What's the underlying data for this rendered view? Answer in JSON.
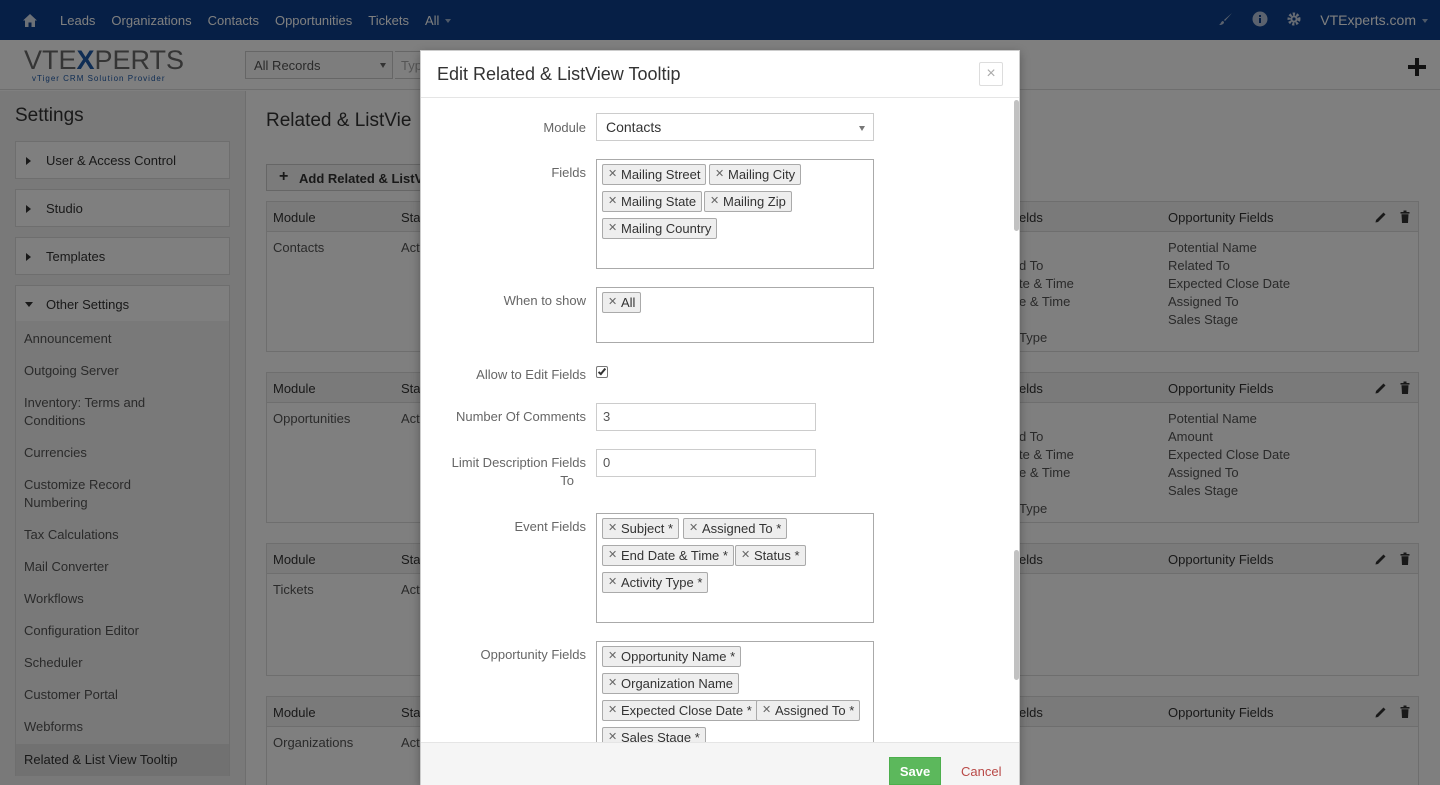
{
  "topnav": {
    "items": [
      "Leads",
      "Organizations",
      "Contacts",
      "Opportunities",
      "Tickets",
      "All"
    ],
    "user": "VTExperts.com"
  },
  "subbar": {
    "logo_main_a": "VTE",
    "logo_main_x": "X",
    "logo_main_b": "PERTS",
    "logo_sub": "vTiger CRM Solution Provider",
    "records_select": "All Records",
    "search_placeholder": "Typ"
  },
  "settings": {
    "title": "Settings",
    "panels": [
      "User & Access Control",
      "Studio",
      "Templates",
      "Other Settings"
    ],
    "submenu": [
      "Announcement",
      "Outgoing Server",
      "Inventory: Terms and Conditions",
      "Currencies",
      "Customize Record Numbering",
      "Tax Calculations",
      "Mail Converter",
      "Workflows",
      "Configuration Editor",
      "Scheduler",
      "Customer Portal",
      "Webforms",
      "Related & List View Tooltip"
    ]
  },
  "main": {
    "title": "Related & ListVie",
    "add_button": "Add Related & ListV",
    "header_module": "Module",
    "header_status": "Sta",
    "header_fields": "elds",
    "header_opp": "Opportunity Fields",
    "blocks": [
      {
        "module": "Contacts",
        "status": "Act",
        "mid": [
          "",
          "d To",
          "te & Time",
          "e & Time",
          "",
          "Type"
        ],
        "opp": [
          "Potential Name",
          "Related To",
          "Expected Close Date",
          "Assigned To",
          "Sales Stage"
        ]
      },
      {
        "module": "Opportunities",
        "status": "Act",
        "mid": [
          "",
          "d To",
          "te & Time",
          "e & Time",
          "",
          "Type"
        ],
        "opp": [
          "Potential Name",
          "Amount",
          "Expected Close Date",
          "Assigned To",
          "Sales Stage"
        ]
      },
      {
        "module": "Tickets",
        "status": "Act",
        "mid": [],
        "opp": []
      },
      {
        "module": "Organizations",
        "status": "Act",
        "mid": [],
        "opp": []
      }
    ]
  },
  "modal": {
    "title": "Edit Related & ListView Tooltip",
    "close": "×",
    "labels": {
      "module": "Module",
      "fields": "Fields",
      "when": "When to show",
      "allow_edit": "Allow to Edit Fields",
      "comments": "Number Of Comments",
      "limit_a": "Limit Description Fields",
      "limit_b": "To",
      "event": "Event Fields",
      "opportunity": "Opportunity Fields"
    },
    "module_value": "Contacts",
    "fields": [
      "Mailing Street",
      "Mailing City",
      "Mailing State",
      "Mailing Zip",
      "Mailing Country"
    ],
    "when_to_show": [
      "All"
    ],
    "allow_edit_checked": true,
    "number_of_comments": "3",
    "limit_description": "0",
    "event_fields": [
      "Subject *",
      "Assigned To *",
      "End Date & Time *",
      "Status *",
      "Activity Type *"
    ],
    "opportunity_fields": [
      "Opportunity Name *",
      "Organization Name",
      "Expected Close Date *",
      "Assigned To *",
      "Sales Stage *"
    ],
    "save": "Save",
    "cancel": "Cancel"
  }
}
